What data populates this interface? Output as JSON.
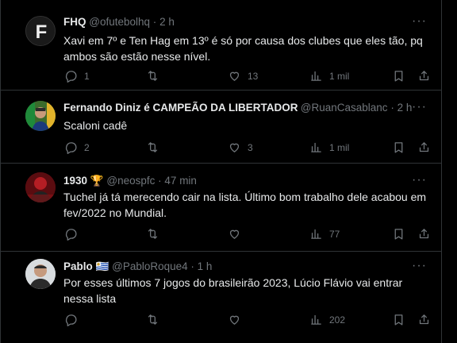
{
  "tweets": [
    {
      "name": "FHQ",
      "handle": "@ofutebolhq",
      "sep": "·",
      "time": "2 h",
      "text": "Xavi em 7º e Ten Hag em 13º é só por causa dos clubes que eles tão, pq ambos são estão nesse nível.",
      "replies": "1",
      "retweets": "",
      "likes": "13",
      "views": "1 mil"
    },
    {
      "name": "Fernando Diniz é CAMPEÃO DA LIBERTADORES",
      "handle": "@RuanCasablanc",
      "sep": "·",
      "time": "2 h",
      "text": "Scaloni cadê",
      "replies": "2",
      "retweets": "",
      "likes": "3",
      "views": "1 mil"
    },
    {
      "name": "1930",
      "badge": "🏆",
      "handle": "@neospfc",
      "sep": "·",
      "time": "47 min",
      "text": "Tuchel já tá merecendo cair na lista. Último bom trabalho dele acabou em fev/2022 no Mundial.",
      "replies": "",
      "retweets": "",
      "likes": "",
      "views": "77"
    },
    {
      "name": "Pablo",
      "badge": "🇺🇾",
      "handle": "@PabloRoque4",
      "sep": "·",
      "time": "1 h",
      "text": "Por esses últimos 7 jogos do brasileirão 2023, Lúcio Flávio vai entrar nessa lista",
      "replies": "",
      "retweets": "",
      "likes": "",
      "views": "202"
    }
  ],
  "more_label": "···",
  "colors": {
    "bg": "#000000",
    "text": "#e7e9ea",
    "muted": "#71767b",
    "border": "#2f3336"
  },
  "icons": [
    "reply-icon",
    "retweet-icon",
    "like-icon",
    "views-icon",
    "bookmark-icon",
    "share-icon",
    "more-icon"
  ]
}
